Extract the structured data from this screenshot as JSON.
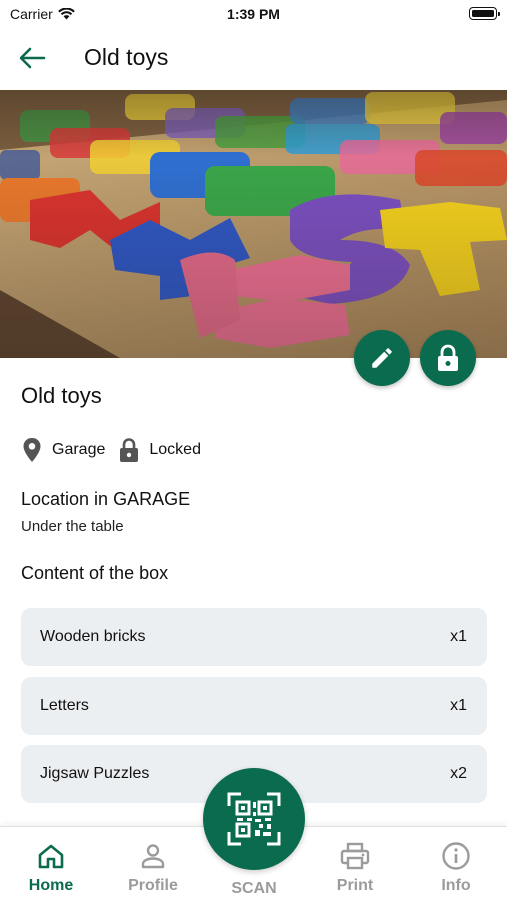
{
  "status_bar": {
    "carrier": "Carrier",
    "time": "1:39 PM"
  },
  "header": {
    "title": "Old toys"
  },
  "box": {
    "name": "Old toys",
    "location_tag": "Garage",
    "lock_status": "Locked",
    "location_title": "Location in GARAGE",
    "location_detail": "Under the table",
    "content_title": "Content of the box"
  },
  "items": [
    {
      "name": "Wooden bricks",
      "qty": "x1"
    },
    {
      "name": "Letters",
      "qty": "x1"
    },
    {
      "name": "Jigsaw Puzzles",
      "qty": "x2"
    }
  ],
  "nav": {
    "home": "Home",
    "profile": "Profile",
    "scan": "SCAN",
    "print": "Print",
    "info": "Info"
  },
  "colors": {
    "accent": "#0b6b4f",
    "card": "#eceff1",
    "inactive": "#9b9b9b"
  }
}
